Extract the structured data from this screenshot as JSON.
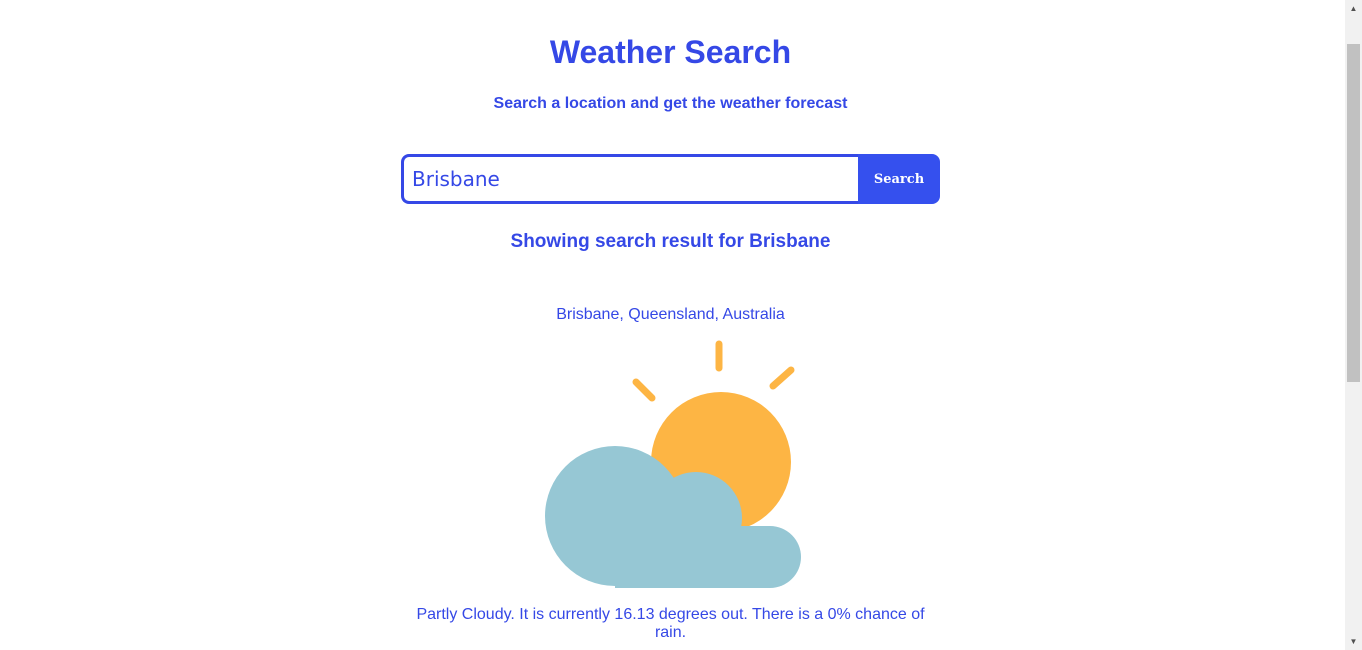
{
  "header": {
    "title": "Weather Search",
    "subtitle": "Search a location and get the weather forecast"
  },
  "search": {
    "value": "Brisbane",
    "button_label": "Search"
  },
  "result": {
    "heading": "Showing search result for Brisbane",
    "location": "Brisbane, Queensland, Australia",
    "icon": "partly-cloudy-icon",
    "description": "Partly Cloudy. It is currently 16.13 degrees out. There is a 0% chance of rain."
  },
  "colors": {
    "accent": "#3548e6",
    "button": "#3550ee",
    "sun": "#fdb544",
    "cloud": "#96c7d4"
  }
}
